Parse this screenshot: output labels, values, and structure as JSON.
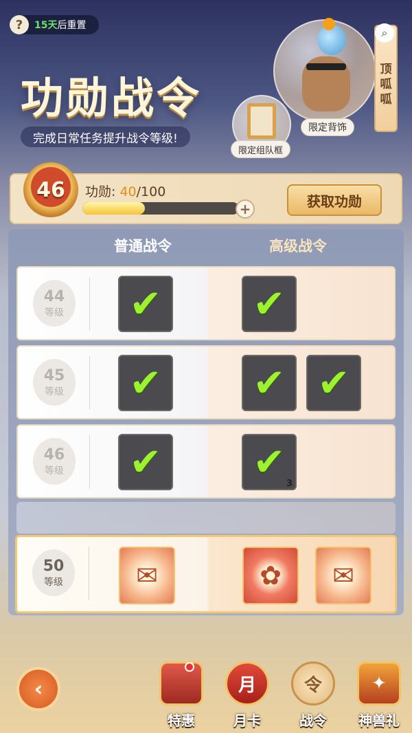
{
  "header": {
    "help": "?",
    "reset_days": "15天",
    "reset_suffix": "后重置",
    "title": "功勋战令",
    "subtitle": "完成日常任务提升战令等级!",
    "side_label": "顶呱呱",
    "limited_accessory": "限定背饰",
    "limited_frame": "限定组队框"
  },
  "progress": {
    "level": "46",
    "label": "功勋:",
    "current": "40",
    "total": "/100",
    "fraction": 0.4,
    "get_button": "获取功勋"
  },
  "columns": {
    "normal": "普通战令",
    "premium": "高级战令"
  },
  "rows": [
    {
      "level": "44",
      "unit": "等级"
    },
    {
      "level": "45",
      "unit": "等级"
    },
    {
      "level": "46",
      "unit": "等级",
      "count": "3"
    },
    {
      "level": "50",
      "unit": "等级"
    }
  ],
  "nav": {
    "tehui": "特惠",
    "yueka": "月卡",
    "yueka_icon": "月",
    "zhanling": "战令",
    "shenshou": "神兽礼"
  },
  "colors": {
    "accent": "#e38d12",
    "check": "#9cf22f"
  }
}
